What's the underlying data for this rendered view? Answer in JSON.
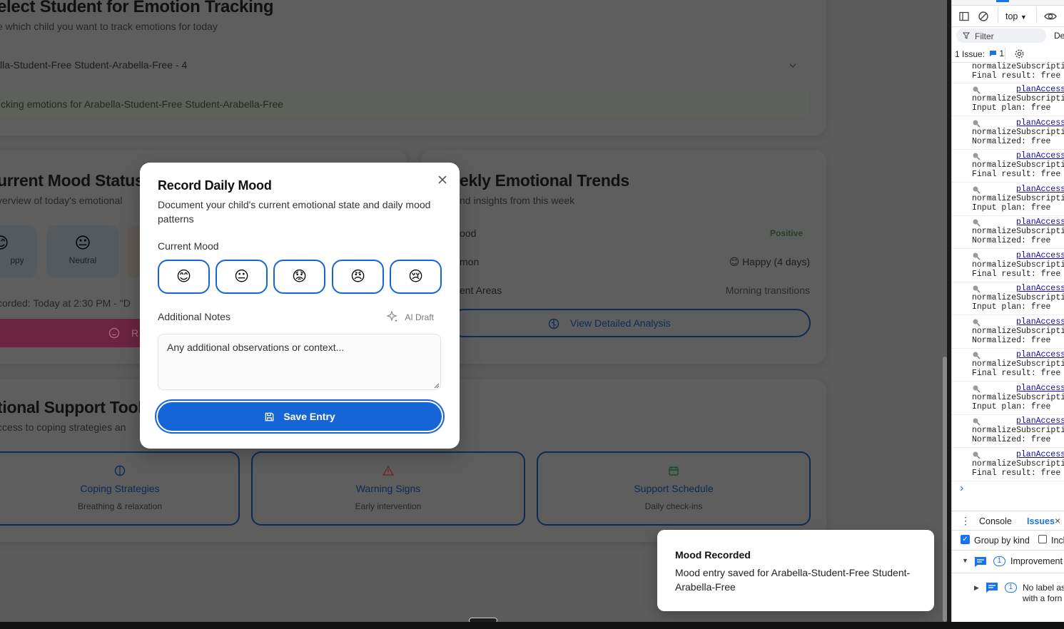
{
  "page": {
    "select_card": {
      "title": "elect Student for Emotion Tracking",
      "subtitle": "e which child you want to track emotions for today",
      "selected_student": "lla-Student-Free Student-Arabella-Free - 4",
      "tracking_note": "cking emotions for Arabella-Student-Free Student-Arabella-Free"
    },
    "mood_status": {
      "title": "urrent Mood Status",
      "subtitle": "verview of today's emotional",
      "chips": [
        {
          "emoji": "😊",
          "label": "ppy"
        },
        {
          "emoji": "😐",
          "label": "Neutral"
        }
      ],
      "recorded_text": "corded: Today at 2:30 PM - \"D",
      "record_btn_text": "R"
    },
    "trends": {
      "title": "ekly Emotional Trends",
      "subtitle": "nd insights from this week",
      "rows": [
        {
          "key": "ood",
          "value": "Positive"
        },
        {
          "key": "mon",
          "value": "😊 Happy (4 days)"
        },
        {
          "key": "ent Areas",
          "value": "Morning transitions"
        }
      ],
      "analysis_button": "View Detailed Analysis"
    },
    "tools": {
      "title": "tional Support Tools",
      "subtitle": "ccess to coping strategies an",
      "cards": [
        {
          "title": "Coping Strategies",
          "sub": "Breathing & relaxation"
        },
        {
          "title": "Warning Signs",
          "sub": "Early intervention"
        },
        {
          "title": "Support Schedule",
          "sub": "Daily check-ins"
        }
      ]
    }
  },
  "modal": {
    "title": "Record Daily Mood",
    "description": "Document your child's current emotional state and daily mood patterns",
    "current_mood_label": "Current Mood",
    "mood_options": [
      "😊",
      "😐",
      "😟",
      "😠",
      "😢"
    ],
    "notes_label": "Additional Notes",
    "ai_draft_label": "AI Draft",
    "notes_placeholder": "Any additional observations or context...",
    "save_button": "Save Entry"
  },
  "toast": {
    "title": "Mood Recorded",
    "message": "Mood entry saved for Arabella-Student-Free Student-Arabella-Free"
  },
  "devtools": {
    "context": "top",
    "filter_label": "Filter",
    "de_label": "De",
    "issues_count_label": "1 Issue:",
    "issues_badge": "1",
    "log_link": "planAccess",
    "log_fn": "normalizeSubscriptio",
    "first_line": "Final result: free",
    "log_entries": [
      "Input plan: free",
      "Normalized: free",
      "Final result: free",
      "Input plan: free",
      "Normalized: free",
      "Final result: free",
      "Input plan: free",
      "Normalized: free",
      "Final result: free",
      "Input plan: free",
      "Normalized: free",
      "Final result: free"
    ],
    "prompt": "›",
    "tabs": [
      "Console",
      "Issues"
    ],
    "group_by_kind": "Group by kind",
    "include_label": "Incl",
    "improvement_label": "Improvement",
    "improvement_count": "1",
    "issue_text_1": "No label as",
    "issue_text_2": "with a forn",
    "issue_count": "1"
  },
  "colors": {
    "primary": "#1565d8",
    "overlay": "#5c5c5c",
    "link": "#1a0dab"
  }
}
